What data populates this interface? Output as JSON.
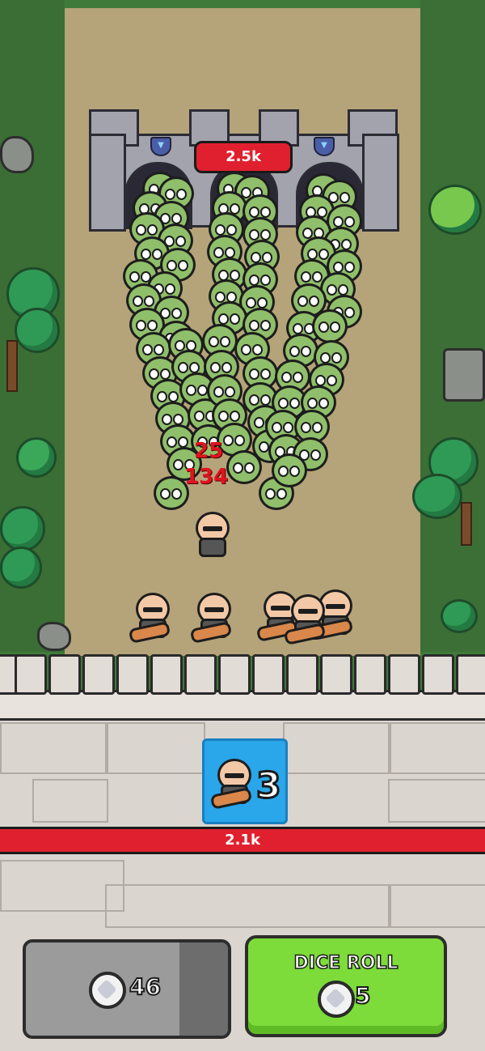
{
  "battle": {
    "enemy_castle_hp": "2.5k",
    "damage_popups": [
      "25",
      "134"
    ]
  },
  "wall": {
    "player_hp": "2.1k"
  },
  "unit_card": {
    "icon": "warrior-icon",
    "count": "3"
  },
  "coins": {
    "icon": "dice-coin-icon",
    "amount": "46"
  },
  "dice_roll": {
    "label": "DICE ROLL",
    "icon": "dice-coin-icon",
    "cost": "5"
  },
  "colors": {
    "hp_bar": "#e0202e",
    "dice_button": "#7ddb3a",
    "unit_card": "#2aa6ea"
  }
}
